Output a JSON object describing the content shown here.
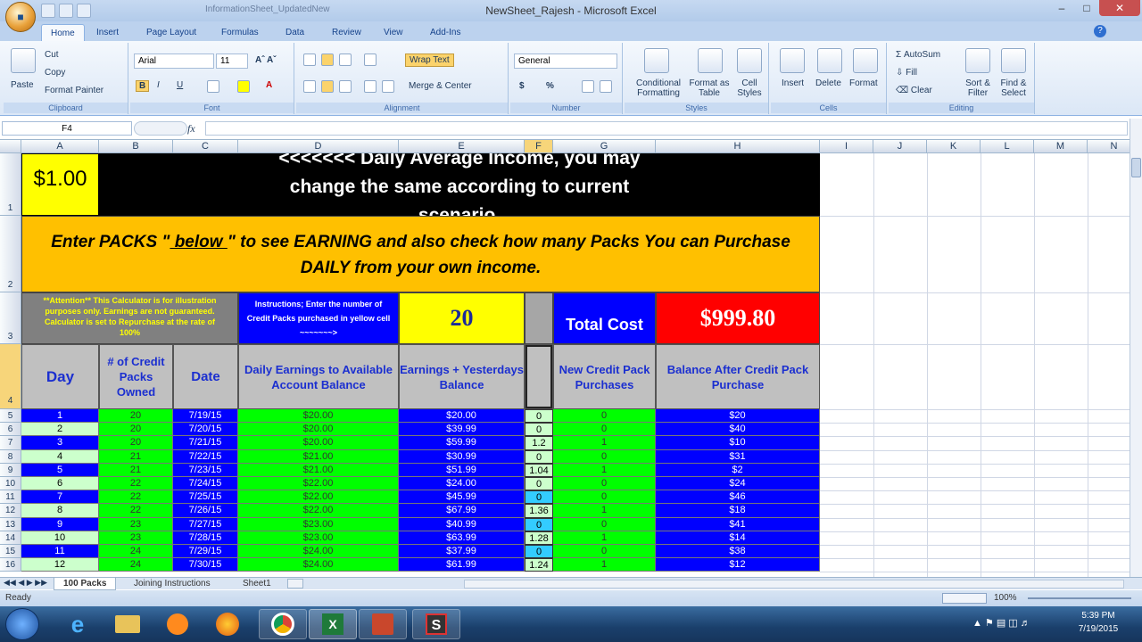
{
  "window": {
    "title": "NewSheet_Rajesh - Microsoft Excel",
    "qat_doc1": "InformationSheet_UpdatedNew",
    "qat_doc2": "Excel"
  },
  "ribbon_tabs": [
    "Home",
    "Insert",
    "Page Layout",
    "Formulas",
    "Data",
    "Review",
    "View",
    "Add-Ins"
  ],
  "ribbon": {
    "paste": "Paste",
    "cut": "Cut",
    "copy": "Copy",
    "format_painter": "Format Painter",
    "font_name": "Arial",
    "font_size": "11",
    "wrap_text": "Wrap Text",
    "merge_center": "Merge & Center",
    "number_format": "General",
    "currency": "$",
    "percent": "%",
    "cond_format": "Conditional Formatting",
    "format_table": "Format as Table",
    "cell_styles": "Cell Styles",
    "insert": "Insert",
    "delete": "Delete",
    "format": "Format",
    "autosum": "AutoSum",
    "fill": "Fill",
    "clear": "Clear",
    "sort_filter": "Sort & Filter",
    "find_select": "Find & Select",
    "groups": [
      "Clipboard",
      "Font",
      "Alignment",
      "Number",
      "Styles",
      "Cells",
      "Editing"
    ]
  },
  "formula_bar": {
    "name_box": "F4",
    "fx": "fx",
    "formula": ""
  },
  "columns": [
    "A",
    "B",
    "C",
    "D",
    "E",
    "F",
    "G",
    "H",
    "I",
    "J",
    "K",
    "L",
    "M",
    "N"
  ],
  "row_numbers": [
    "1",
    "2",
    "3",
    "4",
    "5",
    "6",
    "7",
    "8",
    "9",
    "10",
    "11",
    "12",
    "13",
    "14",
    "15",
    "16"
  ],
  "sheet": {
    "daily_income": "$1.00",
    "banner": "<<<<<<< Daily Average Income, you may change the same according to current scenario.",
    "enter_packs_pre": "Enter PACKS \"",
    "enter_packs_below": " below ",
    "enter_packs_post": "\" to see EARNING and also check how many Packs You can Purchase DAILY from your own income.",
    "attention": "**Attention** This Calculator is for illustration purposes only. Earnings are not guaranteed. Calculator is set to Repurchase at the rate of 100%",
    "instructions": "Instructions; Enter the number of Credit Packs purchased in yellow cell ~~~~~~~>",
    "packs_input": "20",
    "total_cost_label": "Total Cost",
    "total_cost": "$999.80",
    "headers": [
      "Day",
      "# of Credit Packs Owned",
      "Date",
      "Daily Earnings to Available Account Balance",
      "Earnings + Yesterdays Balance",
      "",
      "New Credit Pack Purchases",
      "Balance After Credit Pack Purchase"
    ],
    "rows": [
      [
        "1",
        "20",
        "7/19/15",
        "$20.00",
        "$20.00",
        "0",
        "0",
        "$20"
      ],
      [
        "2",
        "20",
        "7/20/15",
        "$20.00",
        "$39.99",
        "0",
        "0",
        "$40"
      ],
      [
        "3",
        "20",
        "7/21/15",
        "$20.00",
        "$59.99",
        "1.2",
        "1",
        "$10"
      ],
      [
        "4",
        "21",
        "7/22/15",
        "$21.00",
        "$30.99",
        "0",
        "0",
        "$31"
      ],
      [
        "5",
        "21",
        "7/23/15",
        "$21.00",
        "$51.99",
        "1.04",
        "1",
        "$2"
      ],
      [
        "6",
        "22",
        "7/24/15",
        "$22.00",
        "$24.00",
        "0",
        "0",
        "$24"
      ],
      [
        "7",
        "22",
        "7/25/15",
        "$22.00",
        "$45.99",
        "0",
        "0",
        "$46"
      ],
      [
        "8",
        "22",
        "7/26/15",
        "$22.00",
        "$67.99",
        "1.36",
        "1",
        "$18"
      ],
      [
        "9",
        "23",
        "7/27/15",
        "$23.00",
        "$40.99",
        "0",
        "0",
        "$41"
      ],
      [
        "10",
        "23",
        "7/28/15",
        "$23.00",
        "$63.99",
        "1.28",
        "1",
        "$14"
      ],
      [
        "11",
        "24",
        "7/29/15",
        "$24.00",
        "$37.99",
        "0",
        "0",
        "$38"
      ],
      [
        "12",
        "24",
        "7/30/15",
        "$24.00",
        "$61.99",
        "1.24",
        "1",
        "$12"
      ]
    ]
  },
  "sheet_tabs": [
    "100 Packs",
    "Joining Instructions",
    "Sheet1"
  ],
  "status": {
    "ready": "Ready",
    "zoom": "100%"
  },
  "taskbar": {
    "time": "5:39 PM",
    "date": "7/19/2015"
  },
  "colors": {
    "black": "#000000",
    "yellow": "#ffff00",
    "orange": "#ffc000",
    "blue": "#0000ff",
    "green": "#00ff00",
    "red": "#ff0000",
    "gray": "#c0c0c0"
  }
}
